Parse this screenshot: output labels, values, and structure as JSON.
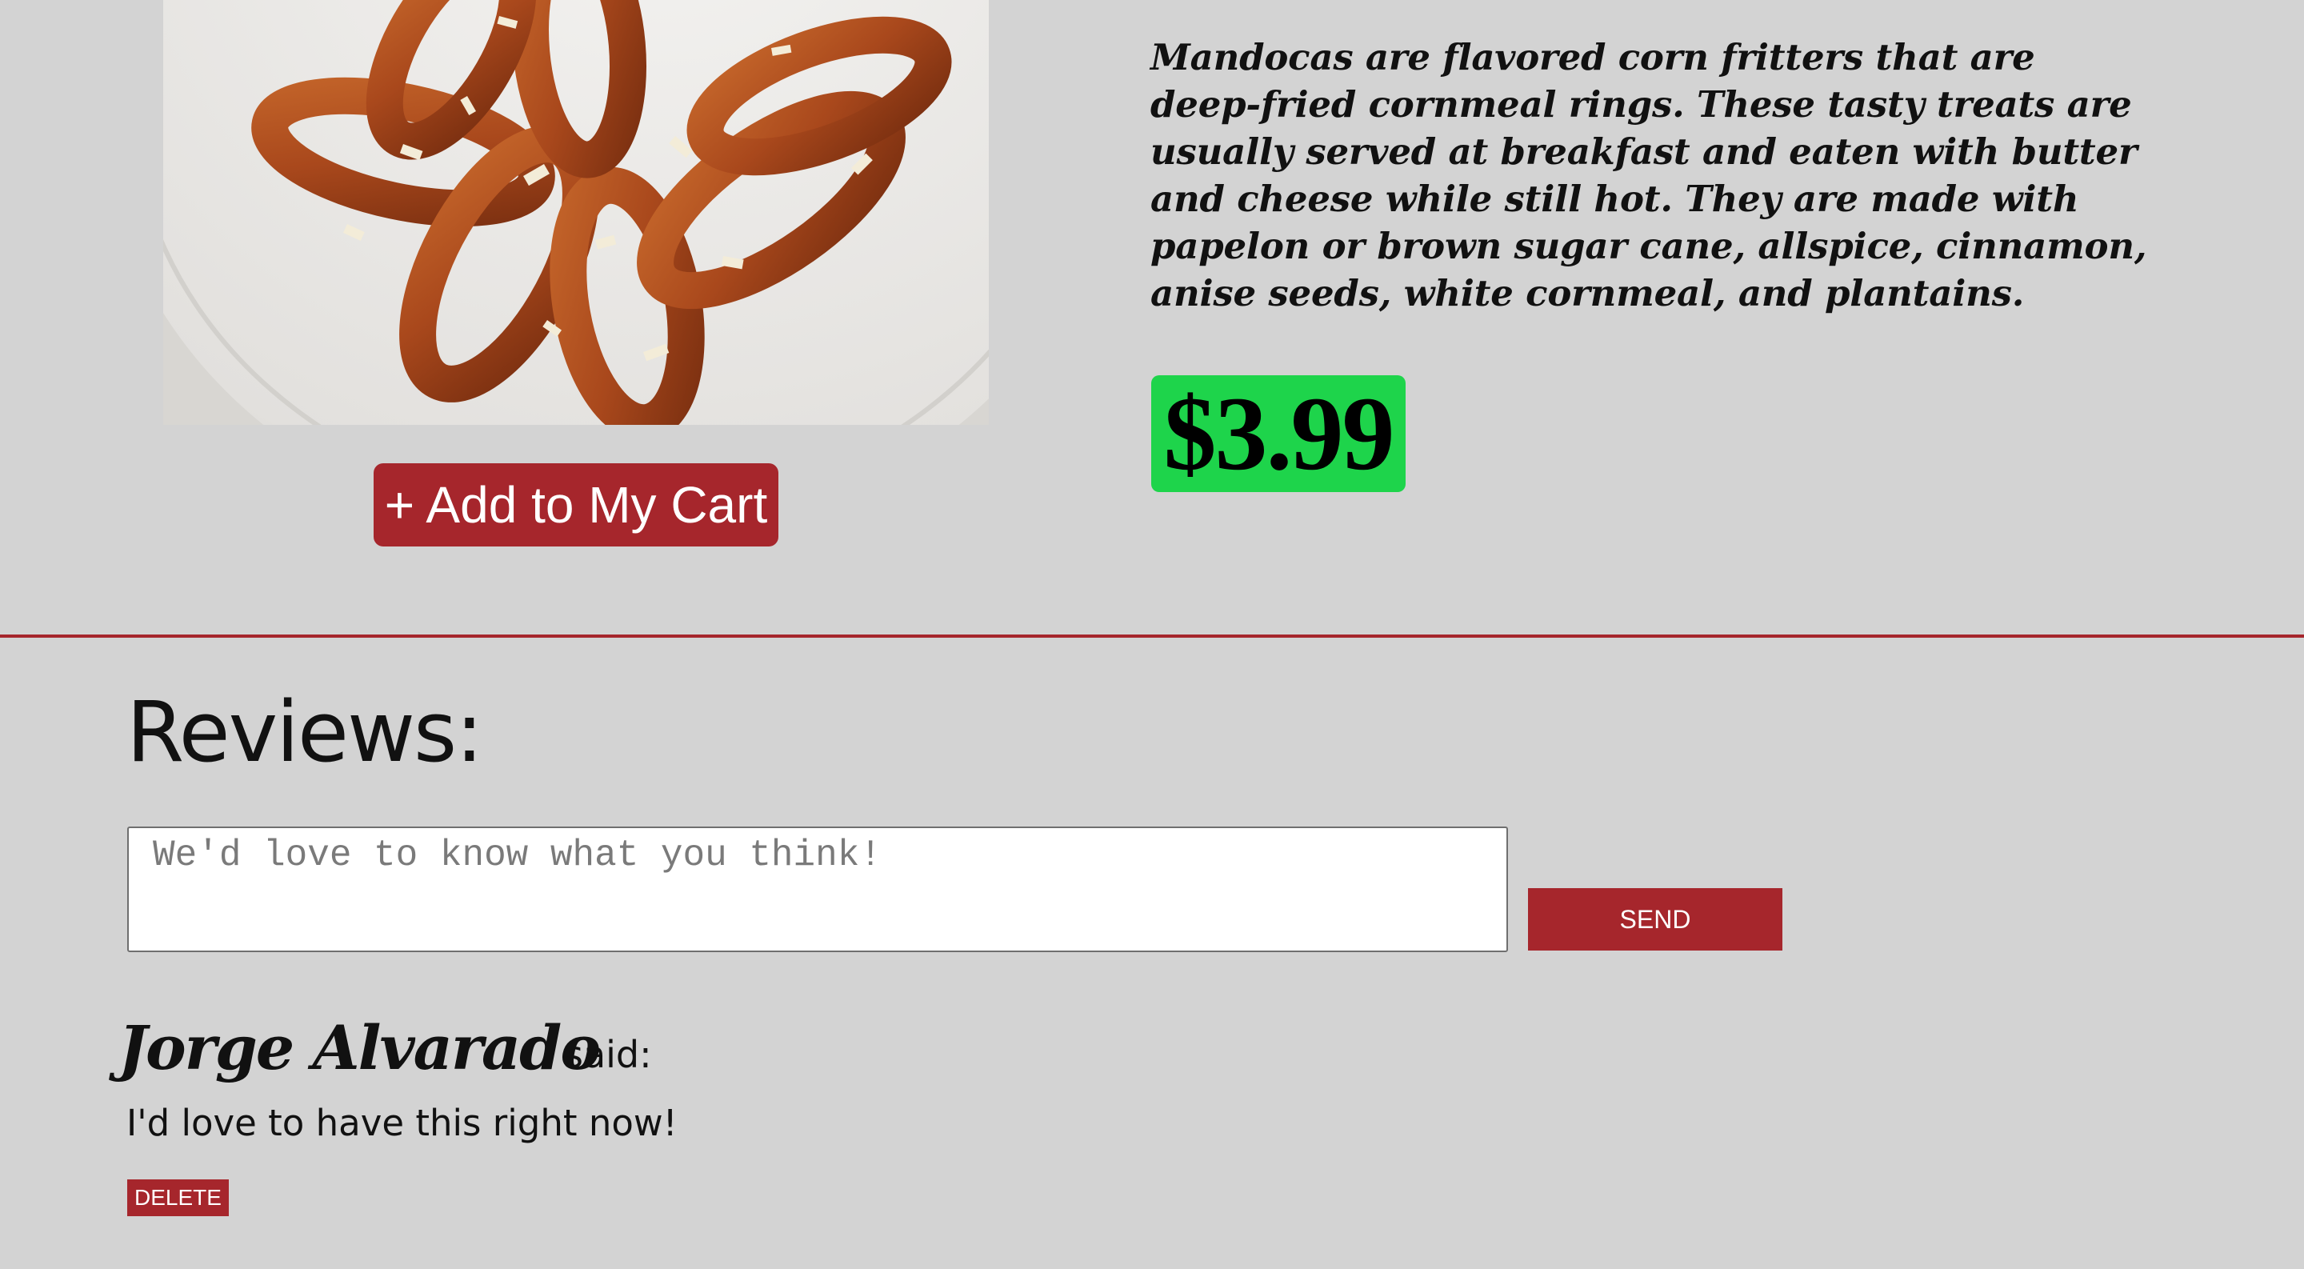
{
  "product": {
    "image_alt": "Mandocas on a plate",
    "add_to_cart_label": "+ Add to My Cart",
    "description": "Mandocas are flavored corn fritters that are deep-fried cornmeal rings. These tasty treats are usually served at breakfast and eaten with butter and cheese while still hot. They are made with papelon or brown sugar cane, allspice, cinnamon, anise seeds, white cornmeal, and plantains.",
    "price": "$3.99"
  },
  "reviews": {
    "heading": "Reviews:",
    "input_placeholder": "We'd love to know what you think!",
    "input_value": "",
    "send_label": "SEND",
    "items": [
      {
        "author": "Jorge Alvarado",
        "said_label": "said:",
        "text": "I'd love to have this right now!",
        "delete_label": "DELETE"
      }
    ]
  },
  "colors": {
    "background": "#d3d3d3",
    "accent_red": "#a6262c",
    "price_green": "#1ed44b"
  }
}
